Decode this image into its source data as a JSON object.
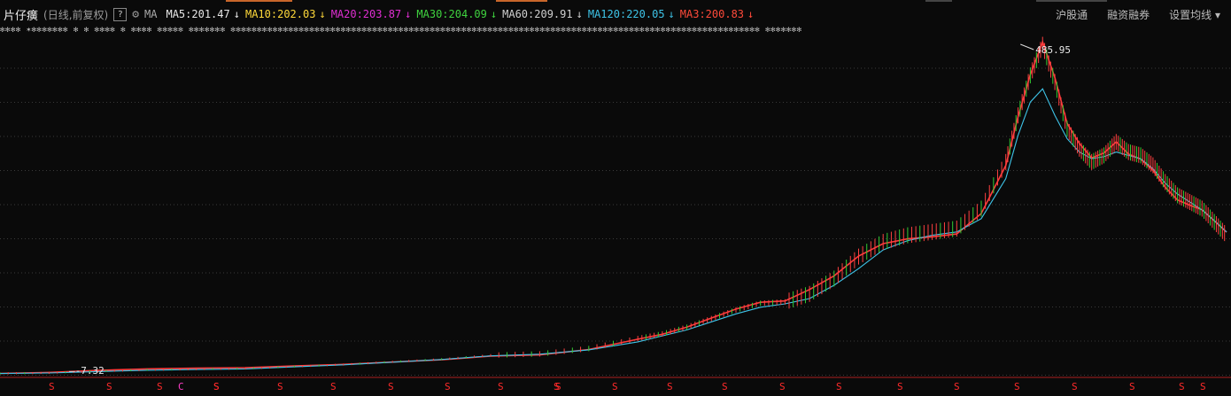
{
  "header": {
    "title": "片仔癀",
    "subtitle": "(日线,前复权)",
    "help": "?",
    "ma_label": "MA",
    "ma_values": [
      {
        "label": "MA5:201.47",
        "arrow": "↓",
        "color": "#e8e8e8"
      },
      {
        "label": "MA10:202.03",
        "arrow": "↓",
        "color": "#ffd93a"
      },
      {
        "label": "MA20:203.87",
        "arrow": "↓",
        "color": "#e02ed2"
      },
      {
        "label": "MA30:204.09",
        "arrow": "↓",
        "color": "#3fd23f"
      },
      {
        "label": "MA60:209.91",
        "arrow": "↓",
        "color": "#cfcfcf"
      },
      {
        "label": "MA120:220.05",
        "arrow": "↓",
        "color": "#3ec4e8"
      },
      {
        "label": "MA3:200.83",
        "arrow": "↓",
        "color": "#ff4a3a"
      }
    ],
    "right_menu": [
      "沪股通",
      "融资融券",
      "设置均线 ▾"
    ]
  },
  "chart_data": {
    "type": "line",
    "title": "片仔癀",
    "price_range": [
      -12,
      500
    ],
    "annotations": {
      "high": "485.95",
      "low": "-7.32"
    },
    "x": [
      0,
      4,
      8,
      12,
      16,
      20,
      24,
      28,
      32,
      36,
      40,
      44,
      48,
      52,
      54,
      56,
      58,
      60,
      62,
      64,
      66,
      68,
      70,
      72,
      74,
      76,
      78,
      80,
      82,
      83,
      84,
      85,
      86,
      87,
      88,
      89,
      90,
      91,
      92,
      93,
      94,
      95,
      96,
      97,
      98,
      99,
      100
    ],
    "series": [
      {
        "name": "price",
        "color": "#ff3b3b",
        "values": [
          -7.32,
          -6.5,
          -4,
          -2,
          -1,
          0,
          3,
          6,
          10,
          14,
          20,
          22,
          30,
          45,
          52,
          62,
          75,
          88,
          98,
          100,
          112,
          135,
          168,
          190,
          200,
          205,
          210,
          240,
          310,
          380,
          440,
          485.95,
          430,
          360,
          330,
          310,
          320,
          340,
          325,
          320,
          305,
          280,
          260,
          250,
          240,
          220,
          200
        ]
      },
      {
        "name": "ma",
        "color": "#3ec4e8",
        "values": [
          -7.5,
          -6.7,
          -4.5,
          -2.5,
          -1.5,
          -0.5,
          2.5,
          5.5,
          9.5,
          13.5,
          19,
          21.5,
          28,
          40,
          49,
          58,
          70,
          82,
          92,
          97,
          105,
          125,
          150,
          178,
          192,
          200,
          205,
          225,
          285,
          350,
          400,
          420,
          380,
          345,
          325,
          315,
          318,
          325,
          320,
          315,
          300,
          278,
          262,
          250,
          238,
          222,
          205
        ]
      }
    ],
    "markers": {
      "s_count": 24,
      "c_count": 1
    }
  },
  "event_strip": "✻✻✻✻ ✶✻✻✻✻✻✻✻ ✻ ✻  ✻✻✻✻ ✻  ✻✻✻✻ ✻✻✻✻✻ ✻✻✻✻✻✻✻ ✻✻✻✻✻✻✻✻✻✻✻✻✻✻✻✻✻✻✻✻✻✻✻✻✻✻✻✻✻✻✻✻✻✻✻✻✻✻✻✻✻✻✻✻✻✻✻✻✻✻✻✻✻✻✻✻✻✻✻✻✻✻✻✻✻✻✻✻✻✻✻✻✻✻✻✻✻✻✻✻✻✻✻✻✻✻✻✻✻✻✻✻✻✻✻✻✻✻✻✻✻ ✻✻✻✻✻✻✻"
}
